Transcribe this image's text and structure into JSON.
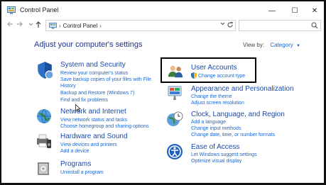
{
  "window": {
    "title": "Control Panel",
    "minimize_glyph": "—",
    "maximize_glyph": "☐",
    "close_glyph": "✕"
  },
  "address": {
    "path": "Control Panel",
    "separator": "›"
  },
  "page": {
    "heading": "Adjust your computer's settings",
    "view_by_label": "View by:",
    "view_by_value": "Category"
  },
  "categories": {
    "system": {
      "title": "System and Security",
      "links": [
        "Review your computer's status",
        "Save backup copies of your files with File",
        "History",
        "Backup and Restore (Windows 7)",
        "Find and fix problems"
      ]
    },
    "network": {
      "title": "Network and Internet",
      "links": [
        "View network status and tasks",
        "Choose homegroup and sharing options"
      ]
    },
    "hardware": {
      "title": "Hardware and Sound",
      "links": [
        "View devices and printers",
        "Add a device"
      ]
    },
    "programs": {
      "title": "Programs",
      "links": [
        "Uninstall a program"
      ]
    },
    "users": {
      "title": "User Accounts",
      "links": [
        "Change account type"
      ]
    },
    "appearance": {
      "title": "Appearance and Personalization",
      "links": [
        "Change the theme",
        "Adjust screen resolution"
      ]
    },
    "clock": {
      "title": "Clock, Language, and Region",
      "links": [
        "Add a language",
        "Change input methods",
        "Change date, time, or number formats"
      ]
    },
    "ease": {
      "title": "Ease of Access",
      "links": [
        "Let Windows suggest settings",
        "Optimize visual display"
      ]
    }
  },
  "colors": {
    "heading": "#1e3287",
    "category_title": "#1a4aa8",
    "link": "#1a66d2",
    "highlight_border": "#000000"
  },
  "icons": [
    "control-panel-icon",
    "back-arrow-icon",
    "forward-arrow-icon",
    "up-arrow-icon",
    "refresh-icon",
    "search-icon",
    "shield-icon",
    "network-globe-icon",
    "printer-speaker-icon",
    "programs-disc-icon",
    "users-icon",
    "uac-shield-icon",
    "paint-palette-icon",
    "clock-globe-icon",
    "ease-of-access-icon",
    "mouse-cursor-icon"
  ]
}
